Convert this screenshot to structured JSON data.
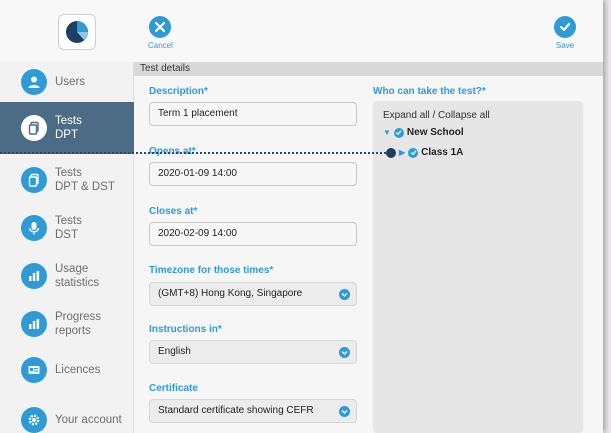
{
  "toolbar": {
    "cancel_label": "Cancel",
    "save_label": "Save",
    "accent_color": "#2e9bd6"
  },
  "section": {
    "title": "Test details"
  },
  "sidebar": {
    "items": [
      {
        "line1": "Users",
        "line2": "",
        "icon": "user-icon",
        "active": false
      },
      {
        "line1": "Tests",
        "line2": "DPT",
        "icon": "document-icon",
        "active": true
      },
      {
        "line1": "Tests",
        "line2": "DPT & DST",
        "icon": "document-icon",
        "active": false
      },
      {
        "line1": "Tests",
        "line2": "DST",
        "icon": "microphone-icon",
        "active": false
      },
      {
        "line1": "Usage",
        "line2": "statistics",
        "icon": "bar-chart-icon",
        "active": false
      },
      {
        "line1": "Progress",
        "line2": "reports",
        "icon": "bar-chart-icon",
        "active": false
      },
      {
        "line1": "Licences",
        "line2": "",
        "icon": "id-card-icon",
        "active": false
      },
      {
        "line1": "Your account",
        "line2": "",
        "icon": "gear-icon",
        "active": false
      }
    ]
  },
  "form": {
    "description": {
      "label": "Description*",
      "value": "Term 1 placement"
    },
    "opens_at": {
      "label": "Opens at*",
      "value": "2020-01-09 14:00"
    },
    "closes_at": {
      "label": "Closes at*",
      "value": "2020-02-09 14:00"
    },
    "timezone": {
      "label": "Timezone for those times*",
      "value": "(GMT+8) Hong Kong, Singapore"
    },
    "instructions": {
      "label": "Instructions in*",
      "value": "English"
    },
    "certificate": {
      "label": "Certificate",
      "value": "Standard certificate showing CEFR"
    }
  },
  "tree": {
    "label": "Who can take the test?*",
    "expand_collapse": "Expand all / Collapse all",
    "nodes": [
      {
        "name": "New School",
        "expanded": true,
        "checked": true
      },
      {
        "name": "Class 1A",
        "expanded": false,
        "checked": true
      }
    ]
  }
}
